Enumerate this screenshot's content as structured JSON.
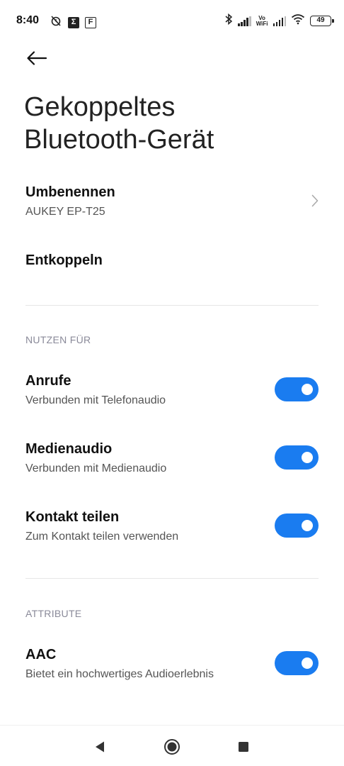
{
  "status_bar": {
    "time": "8:40",
    "box_icon_1": "Σ",
    "box_icon_2": "F",
    "vowifi_top": "Vo",
    "vowifi_bottom": "WiFi",
    "battery": "49"
  },
  "header": {
    "title_line1": "Gekoppeltes",
    "title_line2": "Bluetooth-Gerät"
  },
  "rename": {
    "title": "Umbenennen",
    "subtitle": "AUKEY EP-T25"
  },
  "unpair": {
    "title": "Entkoppeln"
  },
  "use_for": {
    "label": "NUTZEN FÜR",
    "items": [
      {
        "title": "Anrufe",
        "subtitle": "Verbunden mit Telefonaudio",
        "enabled": true
      },
      {
        "title": "Medienaudio",
        "subtitle": "Verbunden mit Medienaudio",
        "enabled": true
      },
      {
        "title": "Kontakt teilen",
        "subtitle": "Zum Kontakt teilen verwenden",
        "enabled": true
      }
    ]
  },
  "attributes": {
    "label": "ATTRIBUTE",
    "items": [
      {
        "title": "AAC",
        "subtitle": "Bietet ein hochwertiges Audioerlebnis",
        "enabled": true
      }
    ]
  },
  "colors": {
    "accent": "#1a7cf0"
  },
  "icons": [
    "alarm-off-icon",
    "bluetooth-icon",
    "signal-icon",
    "wifi-icon",
    "battery-icon",
    "back-arrow-icon",
    "chevron-right-icon",
    "nav-back-icon",
    "nav-home-icon",
    "nav-recents-icon"
  ]
}
